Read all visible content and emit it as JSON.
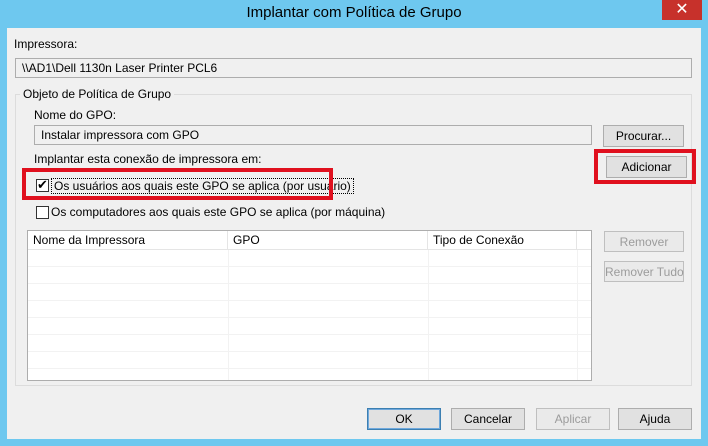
{
  "window": {
    "title": "Implantar com Política de Grupo",
    "close_glyph": "✕"
  },
  "printer": {
    "label": "Impressora:",
    "value": "\\\\AD1\\Dell 1130n Laser Printer PCL6"
  },
  "gpo_group": {
    "legend": "Objeto de Política de Grupo",
    "name_label": "Nome do GPO:",
    "name_value": "Instalar impressora com GPO",
    "browse_button": "Procurar...",
    "deploy_label": "Implantar esta conexão de impressora em:",
    "add_button": "Adicionar",
    "users_checkbox": {
      "label": "Os usuários aos quais este GPO se aplica (por usuário)",
      "checked": true
    },
    "computers_checkbox": {
      "label": "Os computadores aos quais este GPO se aplica (por máquina)",
      "checked": false
    },
    "table": {
      "columns": [
        "Nome da Impressora",
        "GPO",
        "Tipo de Conexão"
      ],
      "rows": []
    },
    "remove_button": "Remover",
    "remove_all_button": "Remover Tudo"
  },
  "footer": {
    "ok": "OK",
    "cancel": "Cancelar",
    "apply": "Aplicar",
    "help": "Ajuda"
  },
  "colors": {
    "highlight": "#e0101e",
    "titlebar": "#6ec8ef",
    "close": "#c7312b"
  }
}
